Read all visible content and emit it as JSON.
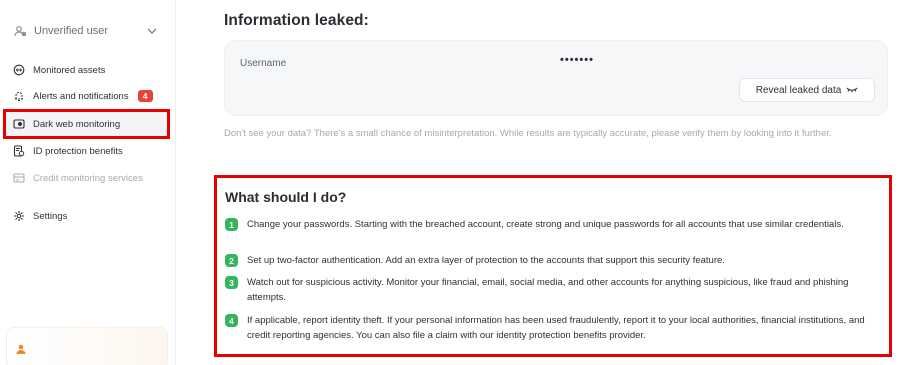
{
  "sidebar": {
    "user": {
      "label": "Unverified user",
      "icon": "user-badge-icon"
    },
    "items": [
      {
        "label": "Monitored assets",
        "icon": "assets-icon"
      },
      {
        "label": "Alerts and notifications",
        "icon": "bell-icon",
        "badge": "4"
      },
      {
        "label": "Dark web monitoring",
        "icon": "dark-web-icon"
      },
      {
        "label": "ID protection benefits",
        "icon": "id-protection-icon"
      },
      {
        "label": "Credit monitoring services",
        "icon": "credit-icon"
      },
      {
        "label": "Settings",
        "icon": "gear-icon"
      }
    ]
  },
  "main": {
    "info_heading": "Information leaked:",
    "leak": {
      "field_label": "Username",
      "masked_value": "•••••••",
      "reveal_label": "Reveal leaked data"
    },
    "note": "Don't see your data? There's a small chance of misinterpretation. While results are typically accurate, please verify them by looking into it further.",
    "what_title": "What should I do?",
    "steps": [
      {
        "num": "1",
        "text": "Change your passwords. Starting with the breached account, create strong and unique passwords for all accounts that use similar credentials."
      },
      {
        "num": "2",
        "text": "Set up two-factor authentication. Add an extra layer of protection to the accounts that support this security feature."
      },
      {
        "num": "3",
        "text": "Watch out for suspicious activity. Monitor your financial, email, social media, and other accounts for anything suspicious, like fraud and phishing attempts."
      },
      {
        "num": "4",
        "text": "If applicable, report identity theft. If your personal information has been used fraudulently, report it to your local authorities, financial institutions, and credit reporting agencies. You can also file a claim with our identity protection benefits provider."
      }
    ]
  },
  "colors": {
    "highlight": "#e60000",
    "badge": "#e8443a",
    "step_green": "#35b45a",
    "accent_orange": "#f08a24"
  }
}
